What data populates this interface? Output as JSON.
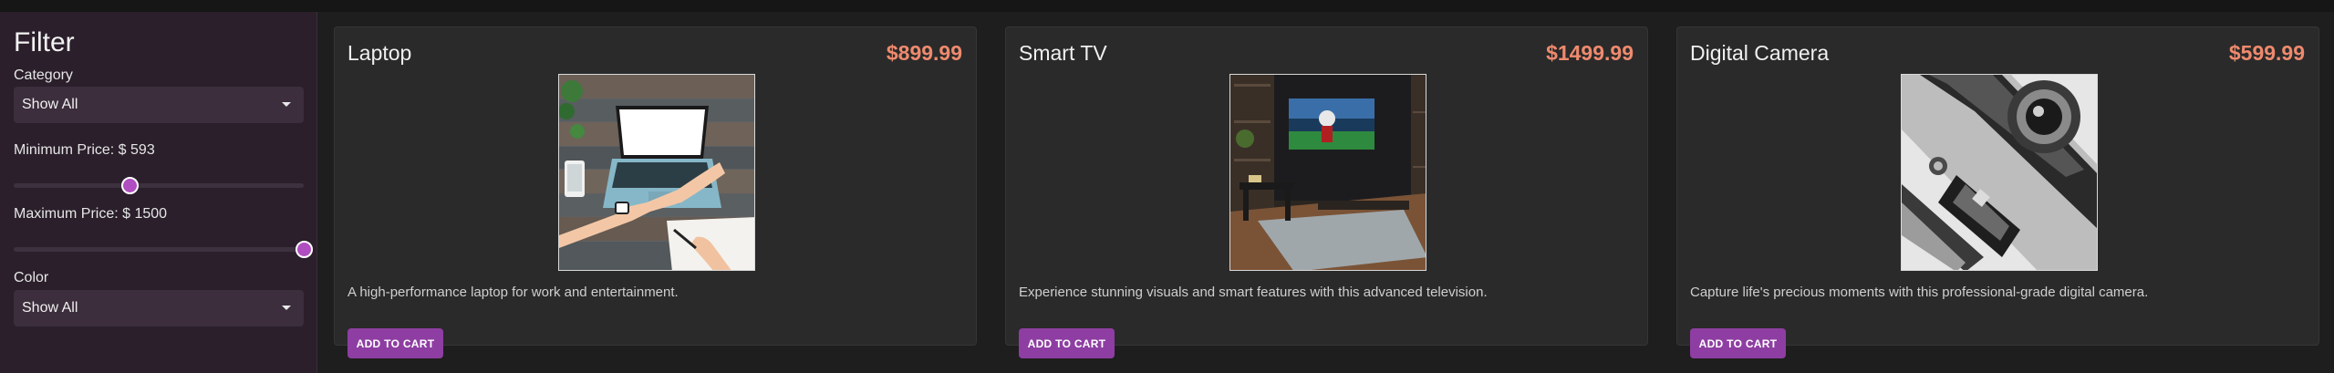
{
  "filter": {
    "title": "Filter",
    "category_label": "Category",
    "category_value": "Show All",
    "min_price_label": "Minimum Price: $ 593",
    "min_price_value": 593,
    "max_price_label": "Maximum Price: $ 1500",
    "max_price_value": 1500,
    "color_label": "Color",
    "color_value": "Show All"
  },
  "products": [
    {
      "name": "Laptop",
      "price": "$899.99",
      "description": "A high-performance laptop for work and entertainment.",
      "button": "ADD TO CART"
    },
    {
      "name": "Smart TV",
      "price": "$1499.99",
      "description": "Experience stunning visuals and smart features with this advanced television.",
      "button": "ADD TO CART"
    },
    {
      "name": "Digital Camera",
      "price": "$599.99",
      "description": "Capture life's precious moments with this professional-grade digital camera.",
      "button": "ADD TO CART"
    }
  ],
  "colors": {
    "accent": "#8e3ea2",
    "price": "#ee8a6e",
    "sidebar": "#2a1f2b"
  },
  "icons": {
    "dropdown": "chevron-down-icon"
  }
}
